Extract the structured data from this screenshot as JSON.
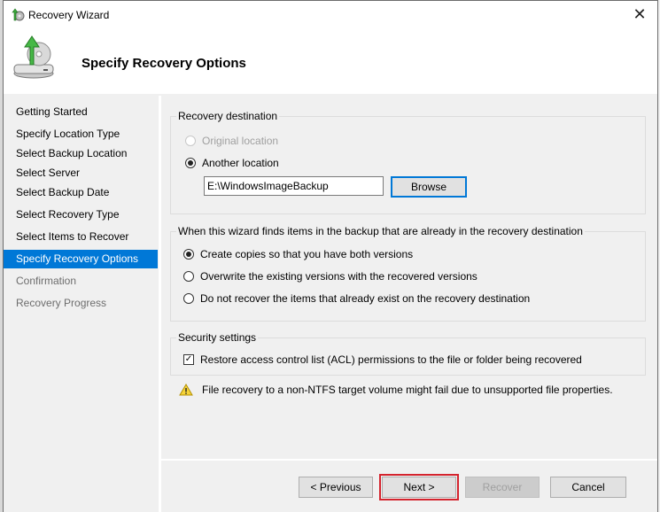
{
  "window": {
    "title": "Recovery Wizard",
    "close_icon": "close-icon",
    "app_icon": "backup-wizard-icon"
  },
  "header": {
    "heading": "Specify Recovery Options",
    "icon": "disk-restore-icon"
  },
  "sidebar": {
    "items": [
      {
        "label": "Getting Started",
        "state": "normal"
      },
      {
        "label": "Specify Location Type",
        "state": "normal"
      },
      {
        "label": "Select Backup Location",
        "state": "normal"
      },
      {
        "label": "Select Server",
        "state": "normal"
      },
      {
        "label": "Select Backup Date",
        "state": "normal"
      },
      {
        "label": "Select Recovery Type",
        "state": "normal"
      },
      {
        "label": "Select Items to Recover",
        "state": "normal"
      },
      {
        "label": "Specify Recovery Options",
        "state": "active"
      },
      {
        "label": "Confirmation",
        "state": "disabled"
      },
      {
        "label": "Recovery Progress",
        "state": "disabled"
      }
    ]
  },
  "destination": {
    "label": "Recovery destination",
    "options": [
      {
        "label": "Original location",
        "checked": false,
        "disabled": true
      },
      {
        "label": "Another location",
        "checked": true,
        "disabled": false
      }
    ],
    "path_value": "E:\\WindowsImageBackup",
    "browse_label": "Browse"
  },
  "conflict": {
    "label": "When this wizard finds items in the backup that are already in the recovery destination",
    "options": [
      {
        "label": "Create copies so that you have both versions",
        "checked": true
      },
      {
        "label": "Overwrite the existing versions with the recovered versions",
        "checked": false
      },
      {
        "label": "Do not recover the items that already exist on the recovery destination",
        "checked": false
      }
    ]
  },
  "security": {
    "label": "Security settings",
    "acl_label": "Restore access control list (ACL) permissions to the file or folder being recovered",
    "acl_checked": true,
    "check_glyph": "✓"
  },
  "warning": {
    "text": "File recovery to a non-NTFS target volume might fail due to unsupported file properties.",
    "icon": "warning-icon"
  },
  "footer": {
    "previous_label": "< Previous",
    "next_label": "Next >",
    "recover_label": "Recover",
    "cancel_label": "Cancel",
    "highlight_color": "#d4242e"
  },
  "colors": {
    "accent": "#0078d7"
  }
}
